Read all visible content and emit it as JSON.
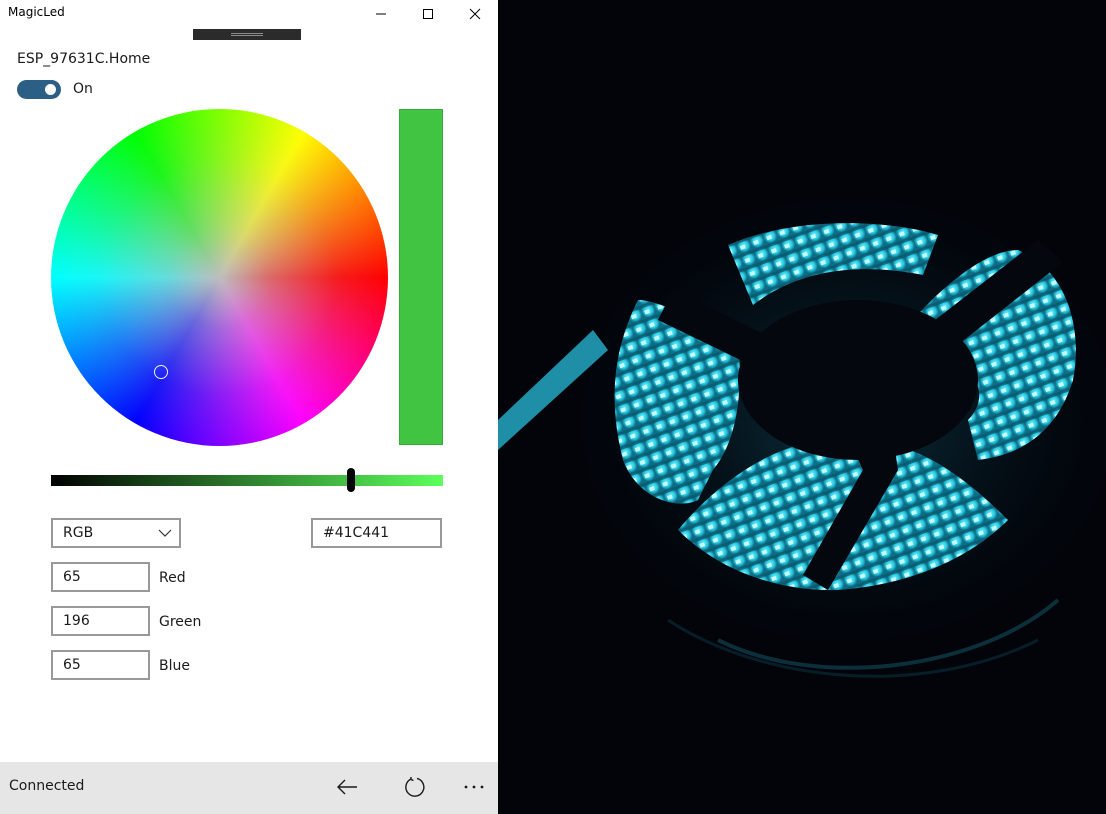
{
  "window": {
    "title": "MagicLed"
  },
  "device": {
    "name": "ESP_97631C.Home",
    "power_label": "On",
    "power_on": true
  },
  "color": {
    "hex": "#41C441",
    "mode": "RGB",
    "channels": [
      {
        "value": "65",
        "label": "Red"
      },
      {
        "value": "196",
        "label": "Green"
      },
      {
        "value": "65",
        "label": "Blue"
      }
    ]
  },
  "status": {
    "text": "Connected"
  },
  "icons": [
    "minimize-icon",
    "maximize-icon",
    "close-icon",
    "chevron-down-icon",
    "back-arrow-icon",
    "refresh-icon",
    "more-icon"
  ]
}
